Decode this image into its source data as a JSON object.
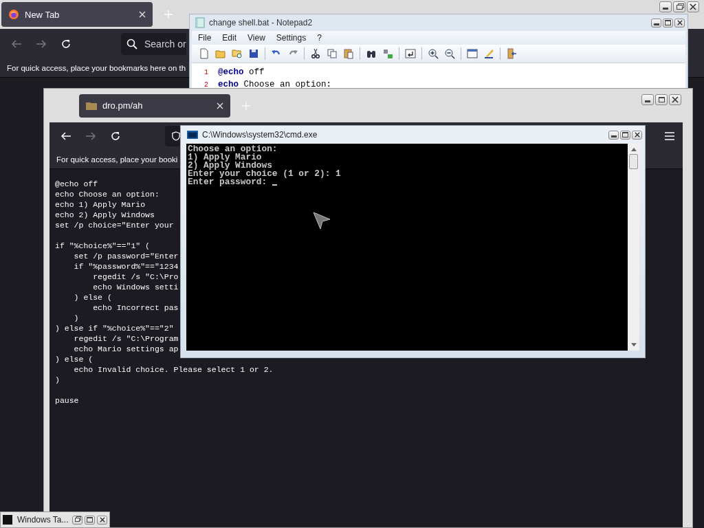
{
  "back_browser": {
    "tab": {
      "title": "New Tab"
    },
    "search": {
      "placeholder": "Search or"
    },
    "bookmarks_hint": "For quick access, place your bookmarks here on th"
  },
  "notepad": {
    "title": "change shell.bat - Notepad2",
    "menu": [
      "File",
      "Edit",
      "View",
      "Settings",
      "?"
    ],
    "lines": [
      {
        "number": "1",
        "text": "**@echo** off"
      },
      {
        "number": "2",
        "text": "**echo** Choose an option:"
      }
    ]
  },
  "front_browser": {
    "tab": {
      "title": "dro.pm/ah"
    },
    "bookmarks_hint": "For quick access, place your booki",
    "page_blocks": [
      [
        "@echo off",
        "echo Choose an option:",
        "echo 1) Apply Mario",
        "echo 2) Apply Windows",
        "set /p choice=\"Enter your"
      ],
      [
        "if \"%choice%\"==\"1\" (",
        "    set /p password=\"Enter",
        "    if \"%password%\"==\"1234",
        "        regedit /s \"C:\\Pro",
        "        echo Windows setti",
        "    ) else (",
        "        echo Incorrect pas",
        "    )",
        ") else if \"%choice%\"==\"2\"",
        "    regedit /s \"C:\\Program",
        "    echo Mario settings ap",
        ") else (",
        "    echo Invalid choice. Please select 1 or 2.",
        ")"
      ],
      [
        "pause"
      ]
    ]
  },
  "cmd": {
    "title": "C:\\Windows\\system32\\cmd.exe",
    "lines": [
      "Choose an option:",
      "1) Apply Mario",
      "2) Apply Windows",
      "Enter your choice (1 or 2): 1"
    ],
    "prompt": "Enter password: "
  },
  "minimized_window": {
    "title": "Windows Ta..."
  }
}
